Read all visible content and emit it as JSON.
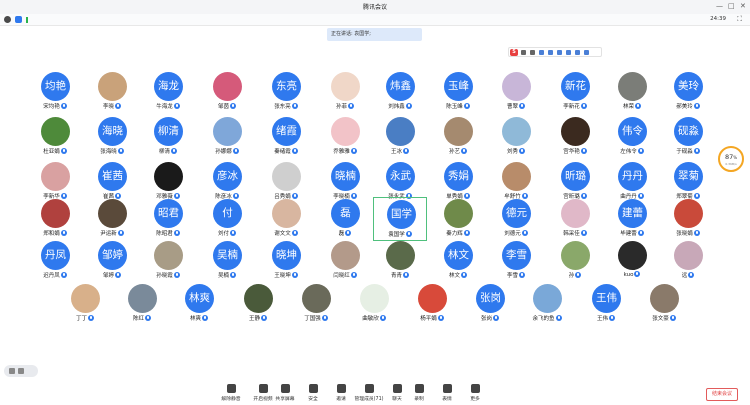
{
  "window": {
    "title": "腾讯会议",
    "time": "24:39"
  },
  "speaking_banner": "正在讲话: 袁国学;",
  "net": {
    "percent": "87",
    "unit": "%",
    "speed": "0.3KB/s"
  },
  "participants": [
    {
      "name": "宋均艳",
      "avatar_text": "均艳",
      "type": "text"
    },
    {
      "name": "李晓",
      "avatar_text": "",
      "type": "photo",
      "color": "#c9a27a"
    },
    {
      "name": "牛海龙",
      "avatar_text": "海龙",
      "type": "text"
    },
    {
      "name": "邹茵",
      "avatar_text": "",
      "type": "photo",
      "color": "#d55a7a"
    },
    {
      "name": "张东亮",
      "avatar_text": "东亮",
      "type": "text"
    },
    {
      "name": "孙菲",
      "avatar_text": "",
      "type": "photo",
      "color": "#f0d7c8"
    },
    {
      "name": "刘炜鑫",
      "avatar_text": "炜鑫",
      "type": "text"
    },
    {
      "name": "陈玉峰",
      "avatar_text": "玉峰",
      "type": "text"
    },
    {
      "name": "曹翠",
      "avatar_text": "",
      "type": "photo",
      "color": "#c8b6d8"
    },
    {
      "name": "李新花",
      "avatar_text": "新花",
      "type": "text"
    },
    {
      "name": "林荣",
      "avatar_text": "",
      "type": "photo",
      "color": "#7b7d78"
    },
    {
      "name": "郝美玲",
      "avatar_text": "美玲",
      "type": "text"
    },
    {
      "name": "杜亚娟",
      "avatar_text": "",
      "type": "photo",
      "color": "#4e8a3a"
    },
    {
      "name": "张海晓",
      "avatar_text": "海晓",
      "type": "text"
    },
    {
      "name": "柳清",
      "avatar_text": "柳清",
      "type": "text"
    },
    {
      "name": "孙娜娜",
      "avatar_text": "",
      "type": "photo",
      "color": "#7fa7d9"
    },
    {
      "name": "秦绪霞",
      "avatar_text": "绪霞",
      "type": "text"
    },
    {
      "name": "乔雅雅",
      "avatar_text": "",
      "type": "photo",
      "color": "#f2c3c8"
    },
    {
      "name": "王冰",
      "avatar_text": "",
      "type": "photo",
      "color": "#4a7ec4"
    },
    {
      "name": "孙艺",
      "avatar_text": "",
      "type": "photo",
      "color": "#a58a6f"
    },
    {
      "name": "刘秀",
      "avatar_text": "",
      "type": "photo",
      "color": "#8fb9d8"
    },
    {
      "name": "宫华艳",
      "avatar_text": "",
      "type": "photo",
      "color": "#3b2a1f"
    },
    {
      "name": "左伟令",
      "avatar_text": "伟令",
      "type": "text"
    },
    {
      "name": "于砚淼",
      "avatar_text": "砚淼",
      "type": "text"
    },
    {
      "name": "李新华",
      "avatar_text": "",
      "type": "photo",
      "color": "#d9a1a1"
    },
    {
      "name": "崔茜",
      "avatar_text": "崔茜",
      "type": "text"
    },
    {
      "name": "邓雅薇",
      "avatar_text": "",
      "type": "photo",
      "color": "#1a1a1a"
    },
    {
      "name": "陈彦冰",
      "avatar_text": "彦冰",
      "type": "text"
    },
    {
      "name": "吕秀娟",
      "avatar_text": "",
      "type": "photo",
      "color": "#cfcfcf"
    },
    {
      "name": "李晓楠",
      "avatar_text": "晓楠",
      "type": "text"
    },
    {
      "name": "张永武",
      "avatar_text": "永武",
      "type": "text"
    },
    {
      "name": "单秀娟",
      "avatar_text": "秀娟",
      "type": "text"
    },
    {
      "name": "牟舒竹",
      "avatar_text": "",
      "type": "photo",
      "color": "#b88c6a"
    },
    {
      "name": "宫昕璐",
      "avatar_text": "昕璐",
      "type": "text"
    },
    {
      "name": "曲丹丹",
      "avatar_text": "丹丹",
      "type": "text"
    },
    {
      "name": "郑翠菊",
      "avatar_text": "翠菊",
      "type": "text"
    },
    {
      "name": "郑和娟",
      "avatar_text": "",
      "type": "photo",
      "color": "#b0413e"
    },
    {
      "name": "尹运新",
      "avatar_text": "",
      "type": "photo",
      "color": "#5a4a3a"
    },
    {
      "name": "陈昭君",
      "avatar_text": "昭君",
      "type": "text"
    },
    {
      "name": "刘付",
      "avatar_text": "付",
      "type": "text"
    },
    {
      "name": "谢文文",
      "avatar_text": "",
      "type": "photo",
      "color": "#d8b6a0"
    },
    {
      "name": "磊",
      "avatar_text": "磊",
      "type": "text"
    },
    {
      "name": "袁国学",
      "avatar_text": "国学",
      "type": "text",
      "active": true
    },
    {
      "name": "秦力辉",
      "avatar_text": "",
      "type": "photo",
      "color": "#6f8a4a"
    },
    {
      "name": "刘德元",
      "avatar_text": "德元",
      "type": "text"
    },
    {
      "name": "韩采佳",
      "avatar_text": "",
      "type": "photo",
      "color": "#e0b8c8"
    },
    {
      "name": "毕建蕾",
      "avatar_text": "建蕾",
      "type": "text"
    },
    {
      "name": "张晓娟",
      "avatar_text": "",
      "type": "photo",
      "color": "#c94a3a"
    },
    {
      "name": "迟丹凤",
      "avatar_text": "丹凤",
      "type": "text"
    },
    {
      "name": "邹婷",
      "avatar_text": "邹婷",
      "type": "text"
    },
    {
      "name": "孙晓霞",
      "avatar_text": "",
      "type": "photo",
      "color": "#a89c86"
    },
    {
      "name": "吴楠",
      "avatar_text": "吴楠",
      "type": "text"
    },
    {
      "name": "王晓坤",
      "avatar_text": "晓坤",
      "type": "text"
    },
    {
      "name": "闫晓红",
      "avatar_text": "",
      "type": "photo",
      "color": "#b39a8a"
    },
    {
      "name": "青青",
      "avatar_text": "",
      "type": "photo",
      "color": "#5a6a4a"
    },
    {
      "name": "林文",
      "avatar_text": "林文",
      "type": "text"
    },
    {
      "name": "李雪",
      "avatar_text": "李雪",
      "type": "text"
    },
    {
      "name": "孙",
      "avatar_text": "",
      "type": "photo",
      "color": "#8aa86a"
    },
    {
      "name": "kuo",
      "avatar_text": "",
      "type": "photo",
      "color": "#2a2a2a"
    },
    {
      "name": "远",
      "avatar_text": "",
      "type": "photo",
      "color": "#c8a8b8"
    },
    {
      "name": "丁丁",
      "avatar_text": "",
      "type": "photo",
      "color": "#d8b08a"
    },
    {
      "name": "陈红",
      "avatar_text": "",
      "type": "photo",
      "color": "#7a8a9a"
    },
    {
      "name": "林爽",
      "avatar_text": "林爽",
      "type": "text"
    },
    {
      "name": "王静",
      "avatar_text": "",
      "type": "photo",
      "color": "#4a5a3a"
    },
    {
      "name": "丁国强",
      "avatar_text": "",
      "type": "photo",
      "color": "#6a6a5a"
    },
    {
      "name": "曲敏欣",
      "avatar_text": "",
      "type": "photo",
      "color": "#e6efe4"
    },
    {
      "name": "杨平娟",
      "avatar_text": "",
      "type": "photo",
      "color": "#d84a3a"
    },
    {
      "name": "张岗",
      "avatar_text": "张岗",
      "type": "text"
    },
    {
      "name": "余飞的鱼",
      "avatar_text": "",
      "type": "photo",
      "color": "#7aa8d8"
    },
    {
      "name": "王伟",
      "avatar_text": "王伟",
      "type": "text"
    },
    {
      "name": "张文豪",
      "avatar_text": "",
      "type": "photo",
      "color": "#8a7a6a"
    }
  ],
  "toolbar": [
    {
      "label": "解除静音",
      "icon": "mic-icon"
    },
    {
      "label": "开启视频",
      "icon": "camera-icon"
    },
    {
      "label": "共享屏幕",
      "icon": "screen-share-icon"
    },
    {
      "label": "安全",
      "icon": "shield-icon"
    },
    {
      "label": "邀请",
      "icon": "invite-icon"
    },
    {
      "label": "管理成员(71)",
      "icon": "members-icon"
    },
    {
      "label": "聊天",
      "icon": "chat-icon"
    },
    {
      "label": "录制",
      "icon": "record-icon"
    },
    {
      "label": "表情",
      "icon": "emoji-icon"
    },
    {
      "label": "更多",
      "icon": "more-icon"
    }
  ],
  "end_button": "结束会议"
}
